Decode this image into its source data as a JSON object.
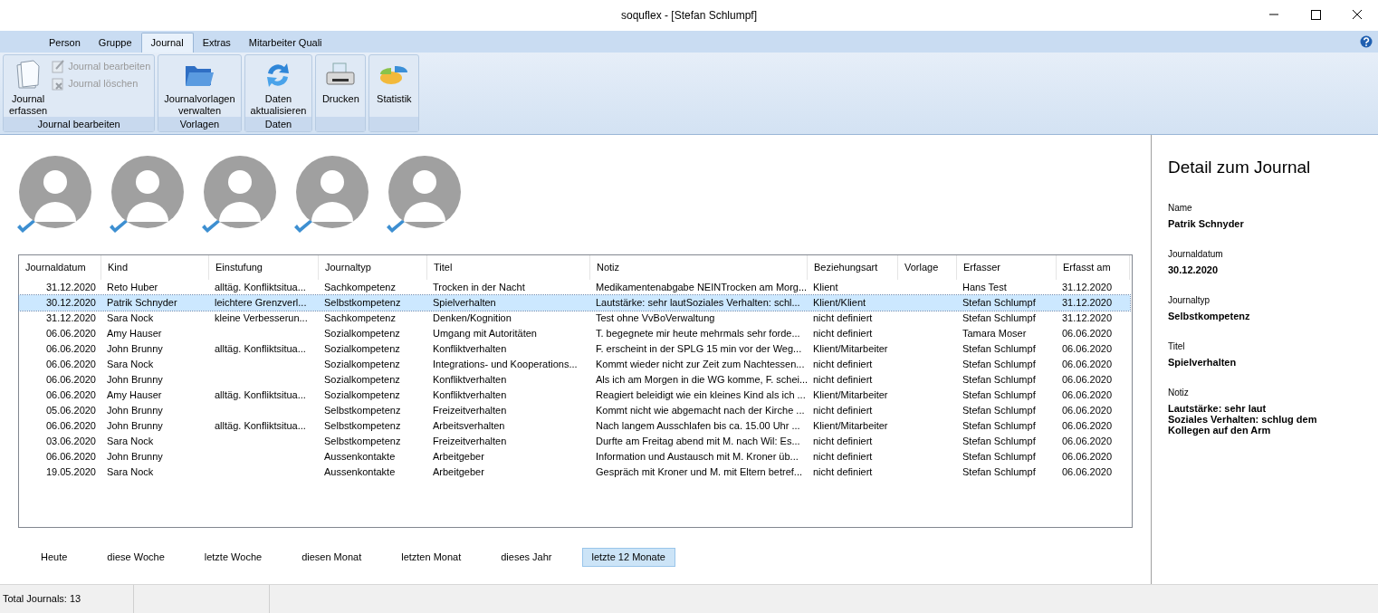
{
  "window": {
    "title": "soquflex - [Stefan Schlumpf]"
  },
  "tabs": [
    {
      "label": "Person",
      "selected": false
    },
    {
      "label": "Gruppe",
      "selected": false
    },
    {
      "label": "Journal",
      "selected": true
    },
    {
      "label": "Extras",
      "selected": false
    },
    {
      "label": "Mitarbeiter Quali",
      "selected": false
    }
  ],
  "ribbon_groups": [
    {
      "label": "Journal bearbeiten",
      "items": [
        {
          "kind": "large",
          "label": "Journal erfassen",
          "disabled": false
        },
        {
          "kind": "small",
          "label": "Journal bearbeiten",
          "disabled": true
        },
        {
          "kind": "small",
          "label": "Journal löschen",
          "disabled": true
        }
      ]
    },
    {
      "label": "Vorlagen",
      "items": [
        {
          "kind": "large",
          "label": "Journalvorlagen verwalten",
          "disabled": false
        }
      ]
    },
    {
      "label": "Daten",
      "items": [
        {
          "kind": "large",
          "label": "Daten aktualisieren",
          "disabled": false
        }
      ]
    },
    {
      "items": [
        {
          "kind": "large",
          "label": "Drucken",
          "disabled": false
        }
      ]
    },
    {
      "items": [
        {
          "kind": "large",
          "label": "Statistik",
          "disabled": false
        }
      ]
    }
  ],
  "avatars": [
    {
      "checked": true
    },
    {
      "checked": true
    },
    {
      "checked": true
    },
    {
      "checked": true
    },
    {
      "checked": true
    }
  ],
  "table": {
    "columns": [
      "Journaldatum",
      "Kind",
      "Einstufung",
      "Journaltyp",
      "Titel",
      "Notiz",
      "Beziehungsart",
      "Vorlage",
      "Erfasser",
      "Erfasst am"
    ],
    "rows": [
      {
        "selected": false,
        "cells": [
          "31.12.2020",
          "Reto Huber",
          "alltäg. Konfliktsitua...",
          "Sachkompetenz",
          "Trocken in der Nacht",
          "Medikamentenabgabe NEINTrocken am Morg...",
          "Klient",
          "",
          "Hans Test",
          "31.12.2020"
        ]
      },
      {
        "selected": true,
        "cells": [
          "30.12.2020",
          "Patrik Schnyder",
          "leichtere Grenzverl...",
          "Selbstkompetenz",
          "Spielverhalten",
          "Lautstärke: sehr lautSoziales Verhalten: schl...",
          "Klient/Klient",
          "",
          "Stefan Schlumpf",
          "31.12.2020"
        ]
      },
      {
        "selected": false,
        "cells": [
          "31.12.2020",
          "Sara Nock",
          "kleine Verbesserun...",
          "Sachkompetenz",
          "Denken/Kognition",
          "Test ohne VvBoVerwaltung",
          "nicht definiert",
          "",
          "Stefan Schlumpf",
          "31.12.2020"
        ]
      },
      {
        "selected": false,
        "cells": [
          "06.06.2020",
          "Amy Hauser",
          "",
          "Sozialkompetenz",
          "Umgang mit Autoritäten",
          "T. begegnete mir heute mehrmals sehr forde...",
          "nicht definiert",
          "",
          "Tamara Moser",
          "06.06.2020"
        ]
      },
      {
        "selected": false,
        "cells": [
          "06.06.2020",
          "John Brunny",
          "alltäg. Konfliktsitua...",
          "Sozialkompetenz",
          "Konfliktverhalten",
          "F. erscheint in der SPLG 15 min vor der Weg...",
          "Klient/Mitarbeiter",
          "",
          "Stefan Schlumpf",
          "06.06.2020"
        ]
      },
      {
        "selected": false,
        "cells": [
          "06.06.2020",
          "Sara Nock",
          "",
          "Sozialkompetenz",
          "Integrations- und Kooperations...",
          "Kommt wieder nicht zur Zeit zum Nachtessen...",
          "nicht definiert",
          "",
          "Stefan Schlumpf",
          "06.06.2020"
        ]
      },
      {
        "selected": false,
        "cells": [
          "06.06.2020",
          "John Brunny",
          "",
          "Sozialkompetenz",
          "Konfliktverhalten",
          "Als ich am Morgen in die WG komme, F. schei...",
          "nicht definiert",
          "",
          "Stefan Schlumpf",
          "06.06.2020"
        ]
      },
      {
        "selected": false,
        "cells": [
          "06.06.2020",
          "Amy Hauser",
          "alltäg. Konfliktsitua...",
          "Sozialkompetenz",
          "Konfliktverhalten",
          "Reagiert beleidigt wie ein kleines Kind als ich ...",
          "Klient/Mitarbeiter",
          "",
          "Stefan Schlumpf",
          "06.06.2020"
        ]
      },
      {
        "selected": false,
        "cells": [
          "05.06.2020",
          "John Brunny",
          "",
          "Selbstkompetenz",
          "Freizeitverhalten",
          "Kommt nicht wie abgemacht nach der Kirche ...",
          "nicht definiert",
          "",
          "Stefan Schlumpf",
          "06.06.2020"
        ]
      },
      {
        "selected": false,
        "cells": [
          "06.06.2020",
          "John Brunny",
          "alltäg. Konfliktsitua...",
          "Selbstkompetenz",
          "Arbeitsverhalten",
          "Nach langem Ausschlafen bis ca. 15.00 Uhr ...",
          "Klient/Mitarbeiter",
          "",
          "Stefan Schlumpf",
          "06.06.2020"
        ]
      },
      {
        "selected": false,
        "cells": [
          "03.06.2020",
          "Sara Nock",
          "",
          "Selbstkompetenz",
          "Freizeitverhalten",
          "Durfte am Freitag abend mit M. nach Wil: Es...",
          "nicht definiert",
          "",
          "Stefan Schlumpf",
          "06.06.2020"
        ]
      },
      {
        "selected": false,
        "cells": [
          "06.06.2020",
          "John Brunny",
          "",
          "Aussenkontakte",
          "Arbeitgeber",
          "Information und Austausch mit M. Kroner üb...",
          "nicht definiert",
          "",
          "Stefan Schlumpf",
          "06.06.2020"
        ]
      },
      {
        "selected": false,
        "cells": [
          "19.05.2020",
          "Sara Nock",
          "",
          "Aussenkontakte",
          "Arbeitgeber",
          "Gespräch mit Kroner und M. mit Eltern betref...",
          "nicht definiert",
          "",
          "Stefan Schlumpf",
          "06.06.2020"
        ]
      }
    ]
  },
  "period_filters": [
    {
      "label": "Heute",
      "selected": false
    },
    {
      "label": "diese Woche",
      "selected": false
    },
    {
      "label": "letzte Woche",
      "selected": false
    },
    {
      "label": "diesen Monat",
      "selected": false
    },
    {
      "label": "letzten Monat",
      "selected": false
    },
    {
      "label": "dieses Jahr",
      "selected": false
    },
    {
      "label": "letzte 12 Monate",
      "selected": true
    }
  ],
  "detail": {
    "title": "Detail zum Journal",
    "fields": [
      {
        "label": "Name",
        "value": "Patrik Schnyder"
      },
      {
        "label": "Journaldatum",
        "value": "30.12.2020"
      },
      {
        "label": "Journaltyp",
        "value": "Selbstkompetenz"
      },
      {
        "label": "Titel",
        "value": "Spielverhalten"
      },
      {
        "label": "Notiz",
        "value": "Lautstärke: sehr laut\nSoziales Verhalten: schlug dem Kollegen auf den Arm"
      }
    ]
  },
  "status_bar": {
    "text": "Total Journals: 13"
  }
}
